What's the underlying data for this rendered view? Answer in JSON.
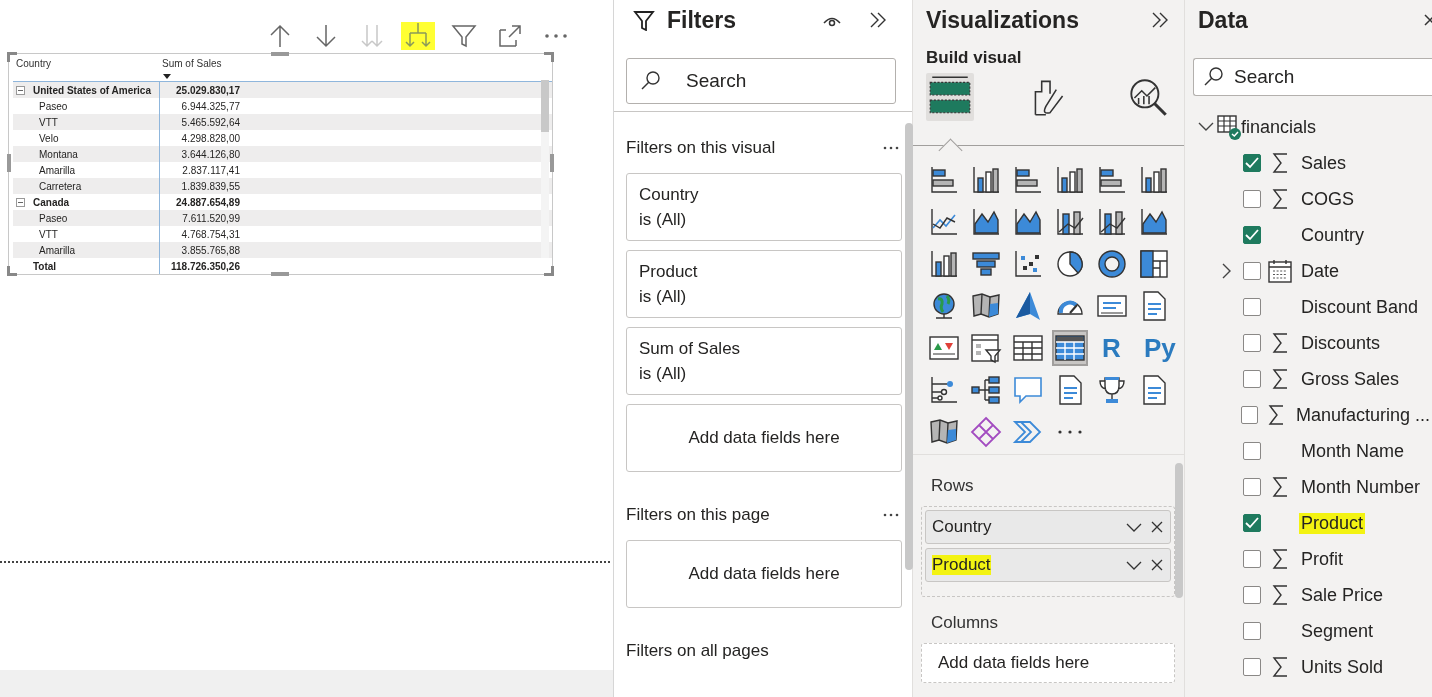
{
  "visual_toolbar": [
    {
      "kind": "up",
      "disabled": false,
      "highlighted": false
    },
    {
      "kind": "down",
      "disabled": false,
      "highlighted": false
    },
    {
      "kind": "nextlevel",
      "disabled": true,
      "highlighted": false
    },
    {
      "kind": "expand",
      "disabled": false,
      "highlighted": true
    },
    {
      "kind": "filter",
      "disabled": false,
      "highlighted": false
    },
    {
      "kind": "focus",
      "disabled": false,
      "highlighted": false
    },
    {
      "kind": "more",
      "disabled": false,
      "highlighted": false
    }
  ],
  "matrix": {
    "columns": [
      "Country",
      "Sum of Sales"
    ],
    "sort_descending": true,
    "rows": [
      {
        "kind": "group",
        "label": "United States of America",
        "value": "25.029.830,17",
        "expanded": true
      },
      {
        "kind": "item",
        "label": "Paseo",
        "value": "6.944.325,77"
      },
      {
        "kind": "item",
        "label": "VTT",
        "value": "5.465.592,64"
      },
      {
        "kind": "item",
        "label": "Velo",
        "value": "4.298.828,00"
      },
      {
        "kind": "item",
        "label": "Montana",
        "value": "3.644.126,80"
      },
      {
        "kind": "item",
        "label": "Amarilla",
        "value": "2.837.117,41"
      },
      {
        "kind": "item",
        "label": "Carretera",
        "value": "1.839.839,55"
      },
      {
        "kind": "group",
        "label": "Canada",
        "value": "24.887.654,89",
        "expanded": true
      },
      {
        "kind": "item",
        "label": "Paseo",
        "value": "7.611.520,99"
      },
      {
        "kind": "item",
        "label": "VTT",
        "value": "4.768.754,31"
      },
      {
        "kind": "item",
        "label": "Amarilla",
        "value": "3.855.765,88"
      },
      {
        "kind": "total",
        "label": "Total",
        "value": "118.726.350,26"
      }
    ]
  },
  "filters": {
    "title": "Filters",
    "search": {
      "placeholder": "Search"
    },
    "sections": [
      {
        "title": "Filters on this visual",
        "menu": true,
        "cards": [
          {
            "kind": "filter",
            "field": "Country",
            "state": "is (All)"
          },
          {
            "kind": "filter",
            "field": "Product",
            "state": "is (All)"
          },
          {
            "kind": "filter",
            "field": "Sum of Sales",
            "state": "is (All)"
          },
          {
            "kind": "empty",
            "text": "Add data fields here"
          }
        ]
      },
      {
        "title": "Filters on this page",
        "menu": true,
        "cards": [
          {
            "kind": "empty",
            "text": "Add data fields here"
          }
        ]
      },
      {
        "title": "Filters on all pages",
        "menu": false
      }
    ]
  },
  "visualizations": {
    "title": "Visualizations",
    "subtitle": "Build visual",
    "modes": [
      {
        "kind": "fields",
        "selected": true
      },
      {
        "kind": "format",
        "selected": false
      },
      {
        "kind": "analytics",
        "selected": false
      }
    ],
    "gallery": [
      {
        "kind": "hbar",
        "selected": false
      },
      {
        "kind": "vbar",
        "selected": false
      },
      {
        "kind": "hbar",
        "selected": false
      },
      {
        "kind": "vbar",
        "selected": false
      },
      {
        "kind": "hbar",
        "selected": false
      },
      {
        "kind": "vbar",
        "selected": false
      },
      {
        "kind": "line",
        "selected": false
      },
      {
        "kind": "area",
        "selected": false
      },
      {
        "kind": "area",
        "selected": false
      },
      {
        "kind": "combo",
        "selected": false
      },
      {
        "kind": "combo",
        "selected": false
      },
      {
        "kind": "area",
        "selected": false
      },
      {
        "kind": "vbar",
        "selected": false
      },
      {
        "kind": "funnel",
        "selected": false
      },
      {
        "kind": "scatter",
        "selected": false
      },
      {
        "kind": "pie",
        "selected": false
      },
      {
        "kind": "donut",
        "selected": false
      },
      {
        "kind": "treemap",
        "selected": false
      },
      {
        "kind": "globe",
        "selected": false
      },
      {
        "kind": "map",
        "selected": false
      },
      {
        "kind": "arrow",
        "selected": false
      },
      {
        "kind": "gauge",
        "selected": false
      },
      {
        "kind": "card",
        "selected": false
      },
      {
        "kind": "doc",
        "selected": false
      },
      {
        "kind": "kpi",
        "selected": false
      },
      {
        "kind": "slicer",
        "selected": false
      },
      {
        "kind": "table",
        "selected": false
      },
      {
        "kind": "table",
        "selected": true
      },
      {
        "kind": "text",
        "label": "R",
        "selected": false
      },
      {
        "kind": "text",
        "label": "Py",
        "selected": false
      },
      {
        "kind": "influencers",
        "selected": false
      },
      {
        "kind": "tree",
        "selected": false
      },
      {
        "kind": "chat",
        "selected": false
      },
      {
        "kind": "doc",
        "selected": false
      },
      {
        "kind": "trophy",
        "selected": false
      },
      {
        "kind": "doc",
        "selected": false
      },
      {
        "kind": "map",
        "selected": false
      },
      {
        "kind": "diamond",
        "selected": false
      },
      {
        "kind": "chevron",
        "selected": false
      },
      {
        "kind": "more",
        "selected": false
      }
    ],
    "wells": [
      {
        "title": "Rows",
        "fields": [
          {
            "label": "Country",
            "highlighted": false
          },
          {
            "label": "Product",
            "highlighted": true
          }
        ]
      },
      {
        "title": "Columns",
        "placeholder": "Add data fields here"
      }
    ]
  },
  "data": {
    "title": "Data",
    "search": {
      "placeholder": "Search"
    },
    "tables": [
      {
        "label": "financials",
        "expanded": true,
        "fields": [
          {
            "label": "Sales",
            "kind": "measure",
            "checked": true,
            "highlighted": false
          },
          {
            "label": "COGS",
            "kind": "measure",
            "checked": false,
            "highlighted": false
          },
          {
            "label": "Country",
            "kind": "text",
            "checked": true,
            "highlighted": false
          },
          {
            "label": "Date",
            "kind": "date",
            "checked": false,
            "highlighted": false,
            "expanded": false
          },
          {
            "label": "Discount Band",
            "kind": "text",
            "checked": false,
            "highlighted": false
          },
          {
            "label": "Discounts",
            "kind": "measure",
            "checked": false,
            "highlighted": false
          },
          {
            "label": "Gross Sales",
            "kind": "measure",
            "checked": false,
            "highlighted": false
          },
          {
            "label": "Manufacturing ...",
            "kind": "measure",
            "checked": false,
            "highlighted": false
          },
          {
            "label": "Month Name",
            "kind": "text",
            "checked": false,
            "highlighted": false
          },
          {
            "label": "Month Number",
            "kind": "measure",
            "checked": false,
            "highlighted": false
          },
          {
            "label": "Product",
            "kind": "text",
            "checked": true,
            "highlighted": true
          },
          {
            "label": "Profit",
            "kind": "measure",
            "checked": false,
            "highlighted": false
          },
          {
            "label": "Sale Price",
            "kind": "measure",
            "checked": false,
            "highlighted": false
          },
          {
            "label": "Segment",
            "kind": "text",
            "checked": false,
            "highlighted": false
          },
          {
            "label": "Units Sold",
            "kind": "measure",
            "checked": false,
            "highlighted": false
          }
        ]
      }
    ]
  }
}
